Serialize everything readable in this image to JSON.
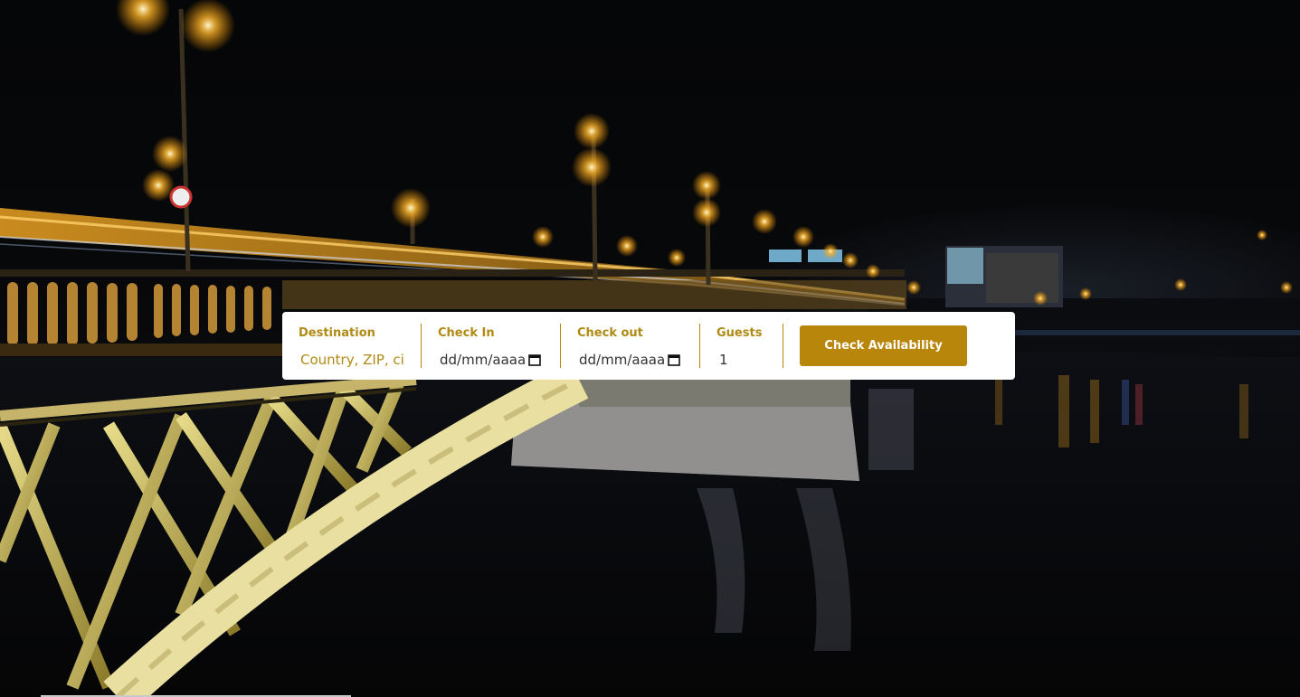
{
  "search": {
    "destination_label": "Destination",
    "destination_placeholder": "Country, ZIP, cit",
    "checkin_label": "Check In",
    "checkin_value": "dd/mm/aaaa",
    "checkout_label": "Check out",
    "checkout_value": "dd/mm/aaaa",
    "guests_label": "Guests",
    "guests_value": "1",
    "button_label": "Check Availability"
  },
  "colors": {
    "accent": "#b8860b",
    "panel": "#ffffff"
  },
  "hero": {
    "image": "night-bridge-photo"
  },
  "icons": [
    "calendar-icon",
    "calendar-icon"
  ]
}
